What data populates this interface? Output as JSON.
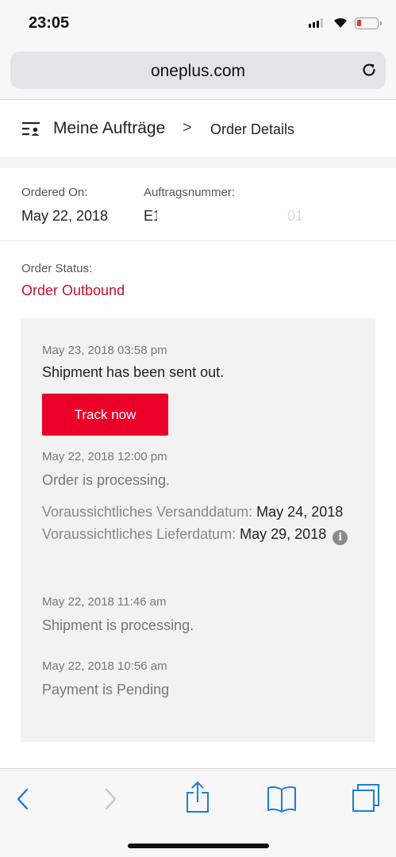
{
  "status_bar": {
    "time": "23:05",
    "battery_level_fraction": 0.15,
    "battery_color": "#e03a2f"
  },
  "browser": {
    "url": "oneplus.com",
    "icons": [
      "reload-icon",
      "back-icon",
      "forward-icon",
      "share-icon",
      "bookmarks-icon",
      "tabs-icon"
    ],
    "accent_color": "#1a7ed6"
  },
  "breadcrumb": {
    "section": "Meine Aufträge",
    "separator": ">",
    "current": "Order Details"
  },
  "order": {
    "ordered_on_label": "Ordered On:",
    "ordered_on_value": "May 22, 2018",
    "number_label": "Auftragsnummer:",
    "number_visible_prefix": "E1",
    "number_visible_suffix": "01",
    "status_label": "Order Status:",
    "status_value": "Order Outbound",
    "status_color": "#c8102e"
  },
  "timeline": [
    {
      "timestamp": "May 23, 2018 03:58 pm",
      "message": "Shipment has been sent out.",
      "button": "Track now"
    },
    {
      "timestamp": "May 22, 2018 12:00 pm",
      "message": "Order is processing."
    },
    {
      "timestamp": "May 22, 2018 11:46 am",
      "message": "Shipment is processing."
    },
    {
      "timestamp": "May 22, 2018 10:56 am",
      "message": "Payment is Pending"
    }
  ],
  "estimates": {
    "shipping_label": "Voraussichtliches Versanddatum:",
    "shipping_value": "May 24, 2018",
    "delivery_label": "Voraussichtliches Lieferdatum:",
    "delivery_value": "May 29, 2018"
  },
  "track_button_color": "#eb0029"
}
